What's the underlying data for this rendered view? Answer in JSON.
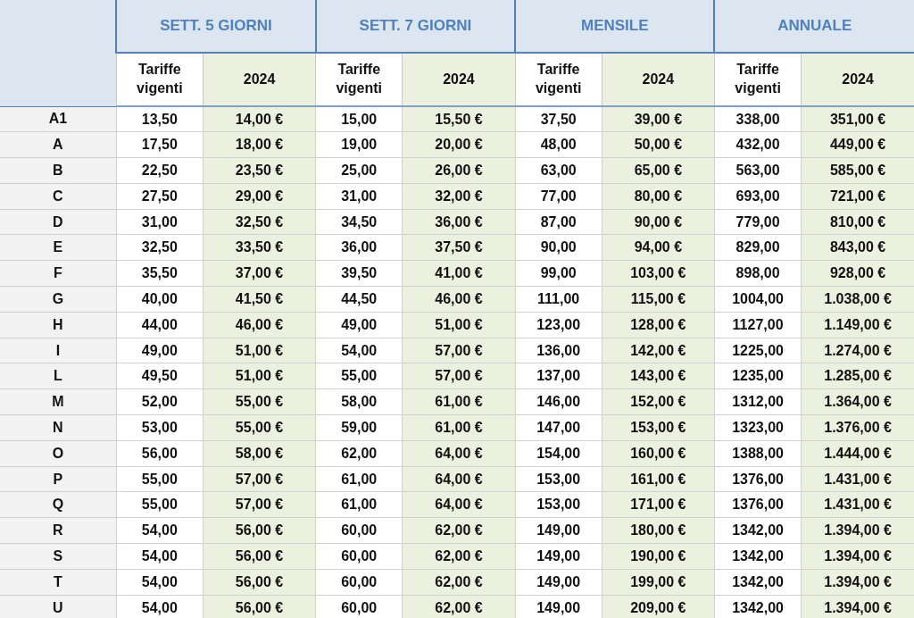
{
  "groups": [
    "SETT. 5 GIORNI",
    "SETT. 7 GIORNI",
    "MENSILE",
    "ANNUALE"
  ],
  "subheaders": [
    {
      "kind": "current",
      "label": "Tariffe vigenti"
    },
    {
      "kind": "new",
      "label": "2024"
    },
    {
      "kind": "current",
      "label": "Tariffe vigenti"
    },
    {
      "kind": "new",
      "label": "2024"
    },
    {
      "kind": "current",
      "label": "Tariffe vigenti"
    },
    {
      "kind": "new",
      "label": "2024"
    },
    {
      "kind": "current",
      "label": "Tariffe vigenti"
    },
    {
      "kind": "new",
      "label": "2024"
    }
  ],
  "rows": [
    {
      "label": "A1",
      "cells": [
        "13,50",
        "14,00 €",
        "15,00",
        "15,50 €",
        "37,50",
        "39,00 €",
        "338,00",
        "351,00 €"
      ]
    },
    {
      "label": "A",
      "cells": [
        "17,50",
        "18,00 €",
        "19,00",
        "20,00 €",
        "48,00",
        "50,00 €",
        "432,00",
        "449,00 €"
      ]
    },
    {
      "label": "B",
      "cells": [
        "22,50",
        "23,50 €",
        "25,00",
        "26,00 €",
        "63,00",
        "65,00 €",
        "563,00",
        "585,00 €"
      ]
    },
    {
      "label": "C",
      "cells": [
        "27,50",
        "29,00 €",
        "31,00",
        "32,00 €",
        "77,00",
        "80,00 €",
        "693,00",
        "721,00 €"
      ]
    },
    {
      "label": "D",
      "cells": [
        "31,00",
        "32,50 €",
        "34,50",
        "36,00 €",
        "87,00",
        "90,00 €",
        "779,00",
        "810,00 €"
      ]
    },
    {
      "label": "E",
      "cells": [
        "32,50",
        "33,50 €",
        "36,00",
        "37,50 €",
        "90,00",
        "94,00 €",
        "829,00",
        "843,00 €"
      ]
    },
    {
      "label": "F",
      "cells": [
        "35,50",
        "37,00 €",
        "39,50",
        "41,00 €",
        "99,00",
        "103,00 €",
        "898,00",
        "928,00 €"
      ]
    },
    {
      "label": "G",
      "cells": [
        "40,00",
        "41,50 €",
        "44,50",
        "46,00 €",
        "111,00",
        "115,00 €",
        "1004,00",
        "1.038,00 €"
      ]
    },
    {
      "label": "H",
      "cells": [
        "44,00",
        "46,00 €",
        "49,00",
        "51,00 €",
        "123,00",
        "128,00 €",
        "1127,00",
        "1.149,00 €"
      ]
    },
    {
      "label": "I",
      "cells": [
        "49,00",
        "51,00 €",
        "54,00",
        "57,00 €",
        "136,00",
        "142,00 €",
        "1225,00",
        "1.274,00 €"
      ]
    },
    {
      "label": "L",
      "cells": [
        "49,50",
        "51,00 €",
        "55,00",
        "57,00 €",
        "137,00",
        "143,00 €",
        "1235,00",
        "1.285,00 €"
      ]
    },
    {
      "label": "M",
      "cells": [
        "52,00",
        "55,00 €",
        "58,00",
        "61,00 €",
        "146,00",
        "152,00 €",
        "1312,00",
        "1.364,00 €"
      ]
    },
    {
      "label": "N",
      "cells": [
        "53,00",
        "55,00 €",
        "59,00",
        "61,00 €",
        "147,00",
        "153,00 €",
        "1323,00",
        "1.376,00 €"
      ]
    },
    {
      "label": "O",
      "cells": [
        "56,00",
        "58,00 €",
        "62,00",
        "64,00 €",
        "154,00",
        "160,00 €",
        "1388,00",
        "1.444,00 €"
      ]
    },
    {
      "label": "P",
      "cells": [
        "55,00",
        "57,00 €",
        "61,00",
        "64,00 €",
        "153,00",
        "161,00 €",
        "1376,00",
        "1.431,00 €"
      ]
    },
    {
      "label": "Q",
      "cells": [
        "55,00",
        "57,00 €",
        "61,00",
        "64,00 €",
        "153,00",
        "171,00 €",
        "1376,00",
        "1.431,00 €"
      ]
    },
    {
      "label": "R",
      "cells": [
        "54,00",
        "56,00 €",
        "60,00",
        "62,00 €",
        "149,00",
        "180,00 €",
        "1342,00",
        "1.394,00 €"
      ]
    },
    {
      "label": "S",
      "cells": [
        "54,00",
        "56,00 €",
        "60,00",
        "62,00 €",
        "149,00",
        "190,00 €",
        "1342,00",
        "1.394,00 €"
      ]
    },
    {
      "label": "T",
      "cells": [
        "54,00",
        "56,00 €",
        "60,00",
        "62,00 €",
        "149,00",
        "199,00 €",
        "1342,00",
        "1.394,00 €"
      ]
    },
    {
      "label": "U",
      "cells": [
        "54,00",
        "56,00 €",
        "60,00",
        "62,00 €",
        "149,00",
        "209,00 €",
        "1342,00",
        "1.394,00 €"
      ]
    }
  ]
}
